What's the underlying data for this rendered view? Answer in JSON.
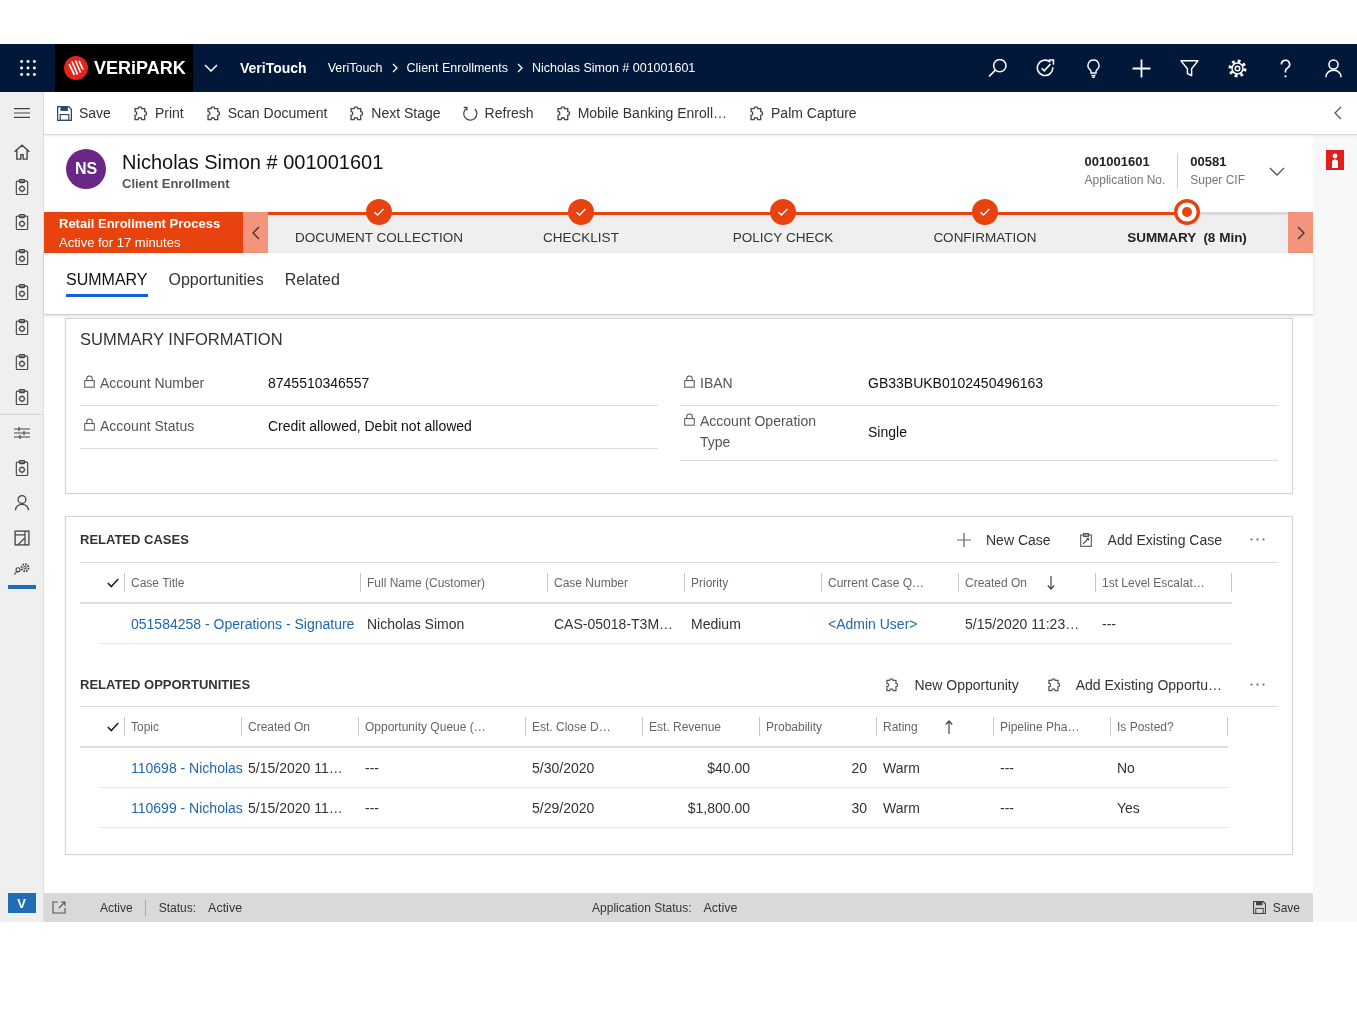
{
  "top_bar": {
    "logo_text": "VERiPARK",
    "app_name": "VeriTouch",
    "breadcrumb": [
      "VeriTouch",
      "Client Enrollments",
      "Nicholas Simon # 001001601"
    ]
  },
  "sidebar": {
    "badge": "V"
  },
  "toolbar": [
    {
      "label": "Save",
      "kind": "save"
    },
    {
      "label": "Print",
      "kind": "puzzle"
    },
    {
      "label": "Scan Document",
      "kind": "puzzle"
    },
    {
      "label": "Next Stage",
      "kind": "puzzle"
    },
    {
      "label": "Refresh",
      "kind": "refresh"
    },
    {
      "label": "Mobile Banking Enroll…",
      "kind": "puzzle"
    },
    {
      "label": "Palm Capture",
      "kind": "puzzle"
    }
  ],
  "record": {
    "initials": "NS",
    "title": "Nicholas Simon # 001001601",
    "subtitle": "Client Enrollment",
    "header_fields": [
      {
        "value": "001001601",
        "label": "Application No."
      },
      {
        "value": "00581",
        "label": "Super CIF"
      }
    ]
  },
  "process": {
    "name": "Retail Enrollment Process",
    "duration": "Active for 17 minutes",
    "stages": [
      {
        "label": "DOCUMENT COLLECTION",
        "done": true,
        "current": false
      },
      {
        "label": "CHECKLIST",
        "done": true,
        "current": false
      },
      {
        "label": "POLICY CHECK",
        "done": true,
        "current": false
      },
      {
        "label": "CONFIRMATION",
        "done": true,
        "current": false
      },
      {
        "label": "SUMMARY",
        "duration": "(8 Min)",
        "done": false,
        "current": true
      }
    ]
  },
  "tabs": [
    {
      "label": "SUMMARY",
      "selected": true
    },
    {
      "label": "Opportunities",
      "selected": false
    },
    {
      "label": "Related",
      "selected": false
    }
  ],
  "summary": {
    "title": "SUMMARY INFORMATION",
    "columns": [
      [
        {
          "label": "Account Number",
          "value": "8745510346557",
          "locked": true
        },
        {
          "label": "Account Status",
          "value": "Credit allowed, Debit not allowed",
          "locked": true
        }
      ],
      [
        {
          "label": "IBAN",
          "value": "GB33BUKB0102450496163",
          "locked": true
        },
        {
          "label": "Account Operation Type",
          "value": "Single",
          "locked": true
        }
      ]
    ]
  },
  "related_cases": {
    "title": "RELATED CASES",
    "commands": [
      {
        "label": "New Case",
        "kind": "add"
      },
      {
        "label": "Add Existing Case",
        "kind": "clipboard"
      }
    ],
    "columns": [
      {
        "label": "Case Title",
        "sort_ascending": false,
        "sort_descending": false
      },
      {
        "label": "Full Name (Customer)",
        "sort_ascending": false,
        "sort_descending": false
      },
      {
        "label": "Case Number",
        "sort_ascending": false,
        "sort_descending": false
      },
      {
        "label": "Priority",
        "sort_ascending": false,
        "sort_descending": false
      },
      {
        "label": "Current Case Q…",
        "sort_ascending": false,
        "sort_descending": false
      },
      {
        "label": "Created On",
        "sort_ascending": false,
        "sort_descending": true
      },
      {
        "label": "1st Level Escalat…",
        "sort_ascending": false,
        "sort_descending": false
      }
    ],
    "rows": [
      {
        "cells": [
          {
            "text": "051584258 - Operations - Signature",
            "kind": "link"
          },
          {
            "text": "Nicholas Simon",
            "kind": "text"
          },
          {
            "text": "CAS-05018-T3M…",
            "kind": "text"
          },
          {
            "text": "Medium",
            "kind": "text"
          },
          {
            "text": "<Admin User>",
            "kind": "link"
          },
          {
            "text": "5/15/2020 11:23…",
            "kind": "text"
          },
          {
            "text": "---",
            "kind": "text"
          }
        ]
      }
    ]
  },
  "related_opportunities": {
    "title": "RELATED OPPORTUNITIES",
    "commands": [
      {
        "label": "New Opportunity",
        "kind": "puzzle"
      },
      {
        "label": "Add Existing Opportu…",
        "kind": "puzzle"
      }
    ],
    "columns": [
      {
        "label": "Topic",
        "sort_ascending": false,
        "sort_descending": false
      },
      {
        "label": "Created On",
        "sort_ascending": false,
        "sort_descending": false
      },
      {
        "label": "Opportunity Queue (…",
        "sort_ascending": false,
        "sort_descending": false
      },
      {
        "label": "Est. Close D…",
        "sort_ascending": false,
        "sort_descending": false
      },
      {
        "label": "Est. Revenue",
        "sort_ascending": false,
        "sort_descending": false
      },
      {
        "label": "Probability",
        "sort_ascending": false,
        "sort_descending": false
      },
      {
        "label": "Rating",
        "sort_ascending": true,
        "sort_descending": false
      },
      {
        "label": "Pipeline Pha…",
        "sort_ascending": false,
        "sort_descending": false
      },
      {
        "label": "Is Posted?",
        "sort_ascending": false,
        "sort_descending": false
      }
    ],
    "rows": [
      {
        "cells": [
          {
            "text": "110698 - Nicholas",
            "kind": "link"
          },
          {
            "text": "5/15/2020 11…",
            "kind": "text"
          },
          {
            "text": "---",
            "kind": "text"
          },
          {
            "text": "5/30/2020",
            "kind": "text"
          },
          {
            "text": "$40.00",
            "kind": "number"
          },
          {
            "text": "20",
            "kind": "number"
          },
          {
            "text": "Warm",
            "kind": "text"
          },
          {
            "text": "---",
            "kind": "text"
          },
          {
            "text": "No",
            "kind": "text"
          }
        ]
      },
      {
        "cells": [
          {
            "text": "110699 - Nicholas",
            "kind": "link"
          },
          {
            "text": "5/15/2020 11…",
            "kind": "text"
          },
          {
            "text": "---",
            "kind": "text"
          },
          {
            "text": "5/29/2020",
            "kind": "text"
          },
          {
            "text": "$1,800.00",
            "kind": "number"
          },
          {
            "text": "30",
            "kind": "number"
          },
          {
            "text": "Warm",
            "kind": "text"
          },
          {
            "text": "---",
            "kind": "text"
          },
          {
            "text": "Yes",
            "kind": "text"
          }
        ]
      }
    ]
  },
  "status_bar": {
    "record_state": "Active",
    "fields": [
      {
        "label": "Status:",
        "value": "Active"
      },
      {
        "label": "Application Status:",
        "value": "Active"
      }
    ],
    "save_label": "Save"
  }
}
